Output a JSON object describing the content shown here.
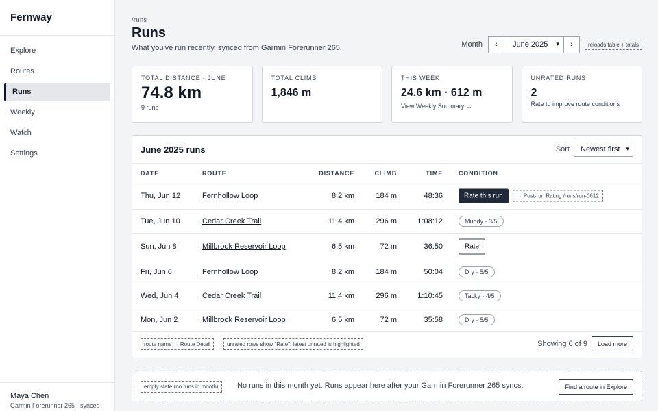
{
  "sidebar": {
    "brand": "Fernway",
    "items": [
      {
        "label": "Explore"
      },
      {
        "label": "Routes"
      },
      {
        "label": "Runs"
      },
      {
        "label": "Weekly"
      },
      {
        "label": "Watch"
      },
      {
        "label": "Settings"
      }
    ],
    "active_index": 2,
    "footer": {
      "name": "Maya Chen",
      "device": "Garmin Forerunner 265 · synced"
    }
  },
  "header": {
    "breadcrumb": "/runs",
    "title": "Runs",
    "subtitle": "What you've run recently, synced from Garmin Forerunner 265.",
    "month_label": "Month",
    "prev_glyph": "‹",
    "next_glyph": "›",
    "selected_month": "June 2025",
    "reload_note": "reloads table + totals"
  },
  "cards": [
    {
      "label": "Total distance · June",
      "value": "74.8 km",
      "sub": "9 runs"
    },
    {
      "label": "Total climb",
      "value": "1,846 m"
    },
    {
      "label": "This week",
      "value": "24.6 km · 612 m",
      "link": "View Weekly Summary →"
    },
    {
      "label": "Unrated runs",
      "value": "2",
      "sub": "Rate to improve route conditions"
    }
  ],
  "table": {
    "title": "June 2025 runs",
    "sort_label": "Sort",
    "sort_value": "Newest first",
    "columns": {
      "date": "Date",
      "route": "Route",
      "distance": "Distance",
      "climb": "Climb",
      "time": "Time",
      "condition": "Condition"
    },
    "rows": [
      {
        "date": "Thu, Jun 12",
        "route": "Fernhollow Loop",
        "distance": "8.2 km",
        "climb": "184 m",
        "time": "48:36",
        "condition": {
          "kind": "button-dark",
          "label": "Rate this run",
          "note": "→ Post-run Rating /runs/run-0612"
        }
      },
      {
        "date": "Tue, Jun 10",
        "route": "Cedar Creek Trail",
        "distance": "11.4 km",
        "climb": "296 m",
        "time": "1:08:12",
        "condition": {
          "kind": "pill",
          "label": "Muddy · 3/5"
        }
      },
      {
        "date": "Sun, Jun 8",
        "route": "Millbrook Reservoir Loop",
        "distance": "6.5 km",
        "climb": "72 m",
        "time": "36:50",
        "condition": {
          "kind": "button-outline",
          "label": "Rate"
        }
      },
      {
        "date": "Fri, Jun 6",
        "route": "Fernhollow Loop",
        "distance": "8.2 km",
        "climb": "184 m",
        "time": "50:04",
        "condition": {
          "kind": "pill",
          "label": "Dry · 5/5"
        }
      },
      {
        "date": "Wed, Jun 4",
        "route": "Cedar Creek Trail",
        "distance": "11.4 km",
        "climb": "296 m",
        "time": "1:10:45",
        "condition": {
          "kind": "pill",
          "label": "Tacky · 4/5"
        }
      },
      {
        "date": "Mon, Jun 2",
        "route": "Millbrook Reservoir Loop",
        "distance": "6.5 km",
        "climb": "72 m",
        "time": "35:58",
        "condition": {
          "kind": "pill",
          "label": "Dry · 5/5"
        }
      }
    ],
    "footer_note_1": "route name → Route Detail",
    "footer_note_2": "unrated rows show \"Rate\"; latest unrated is highlighted",
    "showing": "Showing 6 of 9",
    "load_more": "Load more"
  },
  "empty_state": {
    "note": "empty state (no runs in month)",
    "message": "No runs in this month yet. Runs appear here after your Garmin Forerunner 265 syncs.",
    "button": "Find a route in Explore"
  },
  "colors": {
    "page_bg": "#f3f4f6",
    "panel_bg": "#ffffff",
    "border": "#d1d5db",
    "text": "#111827",
    "primary_button": "#1f2937"
  }
}
